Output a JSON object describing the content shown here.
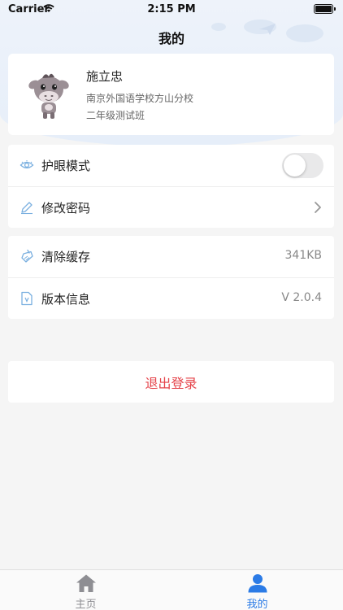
{
  "status_bar": {
    "carrier": "Carrier",
    "time": "2:15 PM"
  },
  "nav": {
    "title": "我的"
  },
  "profile": {
    "name": "施立忠",
    "school": "南京外国语学校方山分校",
    "class_name": "二年级测试班",
    "avatar_icon": "cartoon-donkey-avatar"
  },
  "settings": {
    "eye_care": {
      "label": "护眼模式",
      "icon": "eye-icon",
      "enabled": false
    },
    "change_password": {
      "label": "修改密码",
      "icon": "pencil-icon"
    }
  },
  "info": {
    "clear_cache": {
      "label": "清除缓存",
      "value": "341KB",
      "icon": "broom-icon"
    },
    "version": {
      "label": "版本信息",
      "value": "V 2.0.4",
      "icon": "version-file-icon"
    }
  },
  "logout": {
    "label": "退出登录",
    "color": "#e5434a"
  },
  "tabbar": {
    "tabs": [
      {
        "label": "主页",
        "icon": "home-icon",
        "active": false
      },
      {
        "label": "我的",
        "icon": "user-icon",
        "active": true
      }
    ],
    "active_color": "#2b7be6",
    "inactive_color": "#8e8e93"
  }
}
